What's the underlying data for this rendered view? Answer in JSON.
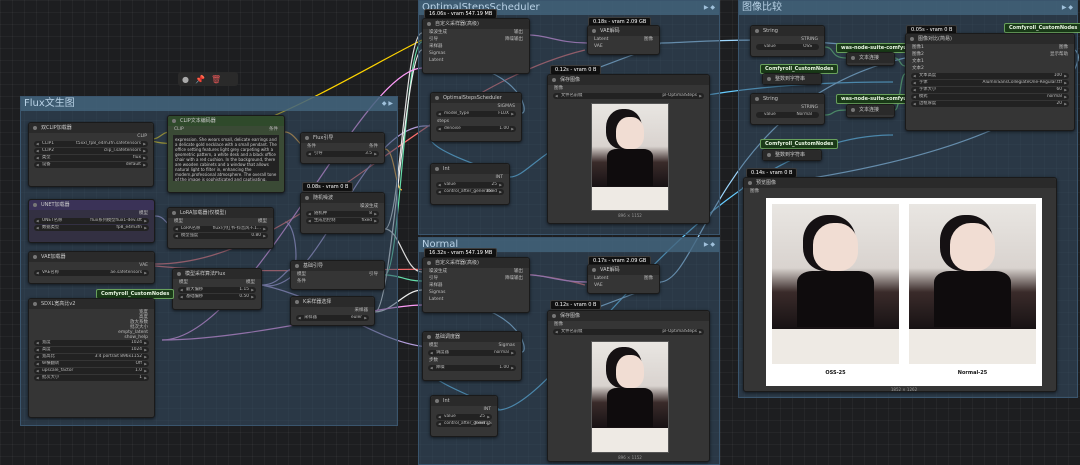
{
  "groups": {
    "flux": {
      "title": "Flux文生图"
    },
    "optimal": {
      "title": "OptimalStepsScheduler"
    },
    "normal": {
      "title": "Normal"
    },
    "compare": {
      "title": "图像比较"
    }
  },
  "toolbar": {
    "color_icon": "●",
    "pin_icon": "📌",
    "delete_icon": "🗑"
  },
  "nodes": {
    "dualclip": {
      "title": "双CLIP加载器",
      "out": "CLIP",
      "w": [
        [
          "CLIP1",
          "t5xxl_fp8_e4m3fn.safetensors"
        ],
        [
          "CLIP2",
          "clip_l.safetensors"
        ],
        [
          "类型",
          "flux"
        ],
        [
          "设备",
          "default"
        ]
      ]
    },
    "clipenc": {
      "title": "CLIP文本编码器",
      "in": "CLIP",
      "out": "条件",
      "text": "expression. She wears small, delicate earrings and a delicate gold necklace with a small pendant. The office setting features light grey carpeting with a geometric pattern, a white desk and a black office chair with a red cushion. In the background, there are wooden cabinets and a window that allows natural light to filter in, enhancing the modern,professional atmosphere. The overall tone of the image is sophisticated and captivating."
    },
    "fluxguide": {
      "title": "Flux引导",
      "in": "条件",
      "out": "条件",
      "w": [
        [
          "引导",
          "3.5"
        ]
      ]
    },
    "unet": {
      "title": "UNET加载器",
      "out": "模型",
      "w": [
        [
          "UNET名称",
          "flux系列模型flux1-dev.sft"
        ],
        [
          "数据类型",
          "fp8_e4m3fn"
        ]
      ]
    },
    "lora": {
      "title": "LoRA加载器(仅模型)",
      "in": "模型",
      "out": "模型",
      "w": [
        [
          "LoRA名称",
          "flux\\小红书-抖音风-F.1..."
        ],
        [
          "模型强度",
          "0.80"
        ]
      ]
    },
    "noise": {
      "title": "随机噪波",
      "badge": "0.08s - vram 0 B",
      "out": "噪波生成",
      "w": [
        [
          "随机种",
          "8"
        ],
        [
          "生成后控制",
          "fixed"
        ]
      ]
    },
    "vae": {
      "title": "VAE加载器",
      "out": "VAE",
      "w": [
        [
          "VAE名称",
          "ae.safetensors"
        ]
      ]
    },
    "modelsamp": {
      "title": "模型采样算法Flux",
      "in": "模型",
      "out": "模型",
      "w": [
        [
          "最大偏移",
          "1.15"
        ],
        [
          "基础偏移",
          "0.50"
        ]
      ]
    },
    "guider": {
      "title": "基础引导",
      "in1": "模型",
      "in2": "条件",
      "out": "引导"
    },
    "ksampsel": {
      "title": "K采样器选择",
      "out": "采样器",
      "w": [
        [
          "采样器",
          "euler"
        ]
      ]
    },
    "sdxlres": {
      "title": "SDXL宽高比v2",
      "badge": "Comfyroll_CustomNodes",
      "outs": [
        "宽度",
        "高度",
        "放大系数",
        "批次大小",
        "empty_latent",
        "show_help"
      ],
      "w": [
        [
          "宽度",
          "1024"
        ],
        [
          "高度",
          "1024"
        ],
        [
          "宽高比",
          "3:4 portrait 896x1152"
        ],
        [
          "纵横翻转",
          "Off"
        ],
        [
          "upscale_factor",
          "1.0"
        ],
        [
          "批次大小",
          "1"
        ]
      ]
    },
    "adv1": {
      "title": "自定义采样器(高级)",
      "badge": "16.06s - vram 547.19 MB",
      "ins": [
        "噪波生成",
        "引导",
        "采样器",
        "Sigmas",
        "Latent"
      ],
      "outs": [
        "输出",
        "降噪输出"
      ]
    },
    "vaedec1": {
      "title": "VAE解码",
      "badge": "0.18s - vram 2.09 GB",
      "ins": [
        "Latent",
        "VAE"
      ],
      "out": "图像"
    },
    "optsched": {
      "title": "OptimalStepsScheduler",
      "out": "SIGMAS",
      "in": "模型",
      "w": [
        [
          "model_type",
          "FLUX"
        ],
        [
          "steps",
          ""
        ],
        [
          "denoise",
          "1.00"
        ]
      ]
    },
    "save1": {
      "title": "保存图像",
      "badge": "0.12s - vram 0 B",
      "in": "图像",
      "w": [
        [
          "文件名前缀",
          "pl-OptimalSteps"
        ]
      ],
      "cap": "896 × 1152"
    },
    "int1": {
      "title": "Int",
      "out": "INT",
      "w": [
        [
          "value",
          "25"
        ],
        [
          "control_after_generate",
          "fixed"
        ]
      ]
    },
    "adv2": {
      "title": "自定义采样器(高级)",
      "badge": "16.32s - vram 547.19 MB",
      "ins": [
        "噪波生成",
        "引导",
        "采样器",
        "Sigmas",
        "Latent"
      ],
      "outs": [
        "输出",
        "降噪输出"
      ]
    },
    "vaedec2": {
      "title": "VAE解码",
      "badge": "0.17s - vram 2.09 GB",
      "ins": [
        "Latent",
        "VAE"
      ],
      "out": "图像"
    },
    "basic": {
      "title": "基础调度器",
      "out": "Sigmas",
      "in": "模型",
      "w": [
        [
          "调度器",
          "normal"
        ],
        [
          "步数",
          ""
        ],
        [
          "降噪",
          "1.00"
        ]
      ]
    },
    "save2": {
      "title": "保存图像",
      "badge": "0.12s - vram 0 B",
      "in": "图像",
      "w": [
        [
          "文件名前缀",
          "pl-OptimalSteps"
        ]
      ],
      "cap": "896 × 1152"
    },
    "int2": {
      "title": "Int",
      "out": "INT",
      "w": [
        [
          "value",
          "25"
        ],
        [
          "control_after_generate",
          "fixed"
        ]
      ]
    },
    "string1": {
      "title": "String",
      "out": "STRING",
      "w": [
        [
          "value",
          "OSS"
        ]
      ]
    },
    "concat1": {
      "title": "文本连接",
      "badge": "was-node-suite-comfyui",
      "badge2": "Comfyroll_CustomNodes"
    },
    "int2str1": {
      "title": "整数到字符串"
    },
    "string2": {
      "title": "String",
      "out": "STRING",
      "w": [
        [
          "value",
          "Normal"
        ]
      ]
    },
    "concat2": {
      "title": "文本连接",
      "badge": "was-node-suite-comfyui",
      "badge2": "Comfyroll_CustomNodes"
    },
    "int2str2": {
      "title": "整数到字符串"
    },
    "imgcompare": {
      "title": "图像对比(简易)",
      "badge": "0.05s - vram 0 B",
      "badge2": "Comfyroll_CustomNodes",
      "ins": [
        "图像1",
        "图像2",
        "文本1",
        "文本2"
      ],
      "outs": [
        "图像",
        "显示帮助"
      ],
      "w": [
        [
          "文本高度",
          "100"
        ],
        [
          "字体",
          "AlumniSansCollegiateOne-Regular.ttf"
        ],
        [
          "字体大小",
          "60"
        ],
        [
          "模式",
          "normal"
        ],
        [
          "边框厚度",
          "20"
        ]
      ]
    },
    "preview": {
      "title": "预览图像",
      "badge": "0.14s - vram 0 B",
      "in": "图像",
      "label1": "OSS-25",
      "label2": "Normal-25",
      "cap": "1852 × 1262"
    }
  }
}
